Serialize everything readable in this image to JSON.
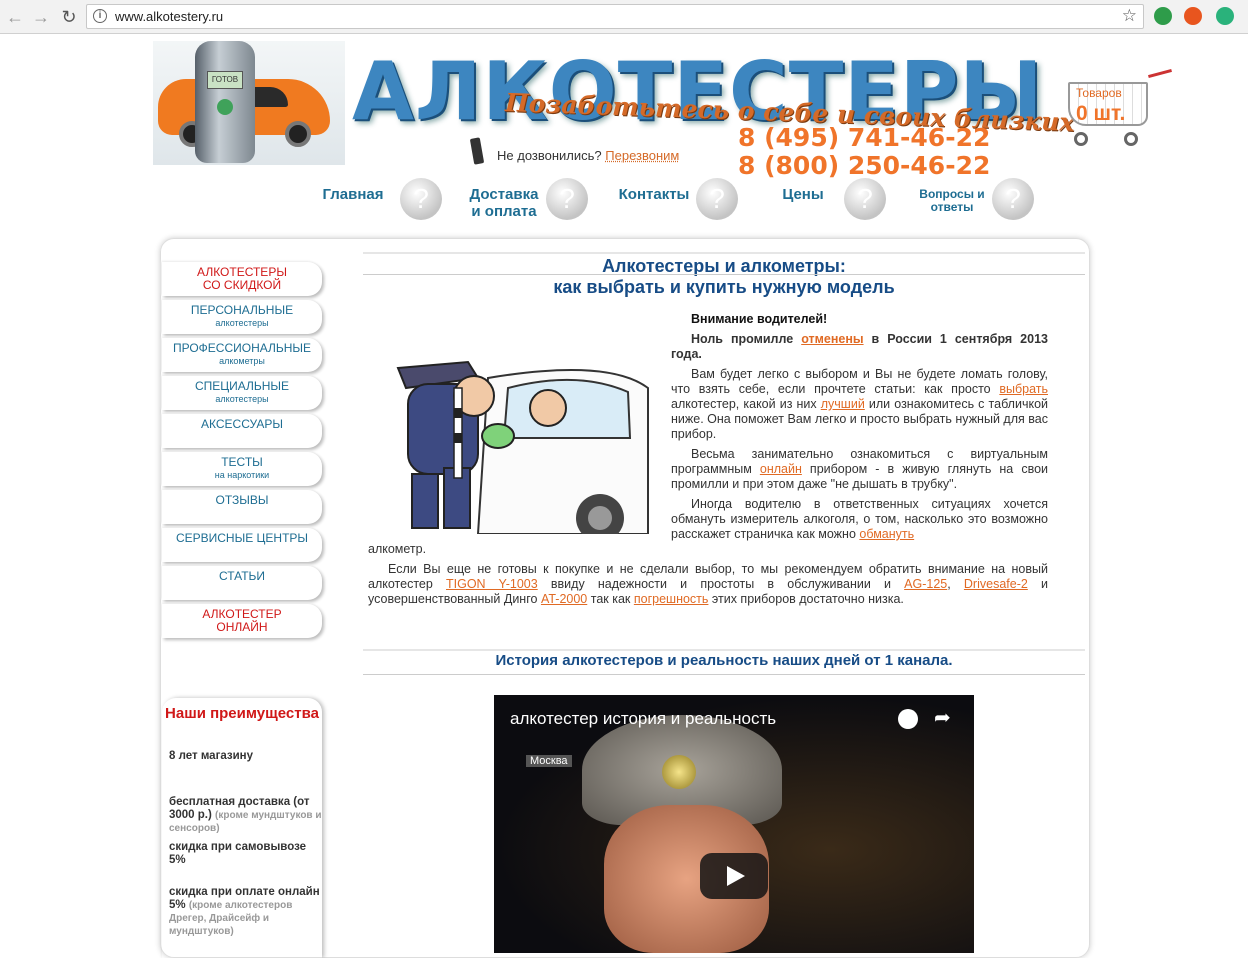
{
  "browser": {
    "url": "www.alkotestery.ru"
  },
  "header": {
    "logo": "АЛКОТЕСТЕРЫ",
    "slogan": "Позаботьтесь о себе и своих близких",
    "callback_prompt": "Не дозвонились?",
    "callback_link": "Перезвоним",
    "phone1": "8 (495) 741-46-22",
    "phone2": "8 (800) 250-46-22",
    "device_screen": "ГОТОВ",
    "cart_label": "Товаров",
    "cart_count": "0 шт."
  },
  "topnav": [
    {
      "label1": "Главная",
      "label2": ""
    },
    {
      "label1": "Доставка",
      "label2": "и оплата"
    },
    {
      "label1": "Контакты",
      "label2": ""
    },
    {
      "label1": "Цены",
      "label2": ""
    },
    {
      "label1": "Вопросы и",
      "label2": "ответы"
    }
  ],
  "sidebar": [
    {
      "a": "АЛКОТЕСТЕРЫ",
      "b": "СО СКИДКОЙ",
      "color": "#d01818"
    },
    {
      "a": "ПЕРСОНАЛЬНЫЕ",
      "b": "алкотестеры",
      "color": "#1e6d92"
    },
    {
      "a": "ПРОФЕССИОНАЛЬНЫЕ",
      "b": "алкометры",
      "color": "#1e6d92"
    },
    {
      "a": "СПЕЦИАЛЬНЫЕ",
      "b": "алкотестеры",
      "color": "#1e6d92"
    },
    {
      "a": "АКСЕССУАРЫ",
      "b": "",
      "color": "#1e6d92"
    },
    {
      "a": "ТЕСТЫ",
      "b": "на наркотики",
      "color": "#1e6d92"
    },
    {
      "a": "ОТЗЫВЫ",
      "b": "",
      "color": "#1e6d92"
    },
    {
      "a": "СЕРВИСНЫЕ ЦЕНТРЫ",
      "b": "",
      "color": "#1e6d92"
    },
    {
      "a": "СТАТЬИ",
      "b": "",
      "color": "#1e6d92"
    },
    {
      "a": "АЛКОТЕСТЕР",
      "b": "ОНЛАЙН",
      "color": "#d01818"
    }
  ],
  "advantages": {
    "title": "Наши преимущества",
    "items": [
      {
        "main": "8 лет магазину",
        "note": ""
      },
      {
        "main": "бесплатная доставка (от 3000 р.)",
        "note": "(кроме мундштуков и сенсоров)"
      },
      {
        "main": "скидка при самовывозе 5%",
        "note": ""
      },
      {
        "main": "скидка при оплате онлайн 5%",
        "note": "(кроме алкотестеров Дрегер, Драйсейф и мундштуков)"
      }
    ]
  },
  "main": {
    "title1": "Алкотестеры и алкометры:",
    "title2": "как выбрать и купить нужную модель",
    "attention": "Внимание водителей!",
    "p0_pre": "Ноль промилле ",
    "p0_link": "отменены",
    "p0_post": " в России 1 сентября 2013 года",
    "p1_a": "Вам будет легко с выбором и Вы не будете ломать голову, что взять себе, если прочтете статьи: как просто ",
    "p1_link1": "выбрать",
    "p1_b": " алкотестер, какой из них ",
    "p1_link2": "лучший",
    "p1_c": " или ознакомитесь с табличкой ниже. Она поможет Вам легко и просто выбрать нужный для вас прибор.",
    "p2_a": "Весьма занимательно ознакомиться с виртуальным программным ",
    "p2_link": "онлайн",
    "p2_b": " прибором - в живую глянуть на свои промилли и при этом даже \"не дышать в трубку\".",
    "p3_a": "Иногда водителю в ответственных ситуациях хочется обмануть измеритель алкоголя, о том, насколько это возможно расскажет страничка как можно ",
    "p3_link": "обмануть",
    "p3_b": "алкометр.",
    "p4_a": "Если Вы еще не готовы к покупке и не сделали выбор, то мы рекомендуем обратить внимание на новый алкотестер ",
    "p4_link1": "TIGON Y-1003",
    "p4_b": " ввиду надежности и простоты в обслуживании и ",
    "p4_link2": "AG-125",
    "p4_c": ", ",
    "p4_link3": "Drivesafe-2",
    "p4_d": " и усовершенствованный Динго ",
    "p4_link4": "AT-2000",
    "p4_e": " так как ",
    "p4_link5": "погрешность",
    "p4_f": " этих приборов достаточно низка.",
    "section2": "История алкотестеров и реальность наших дней от 1 канала.",
    "video_title": "алкотестер история и реальность",
    "video_caption": "Москва"
  }
}
